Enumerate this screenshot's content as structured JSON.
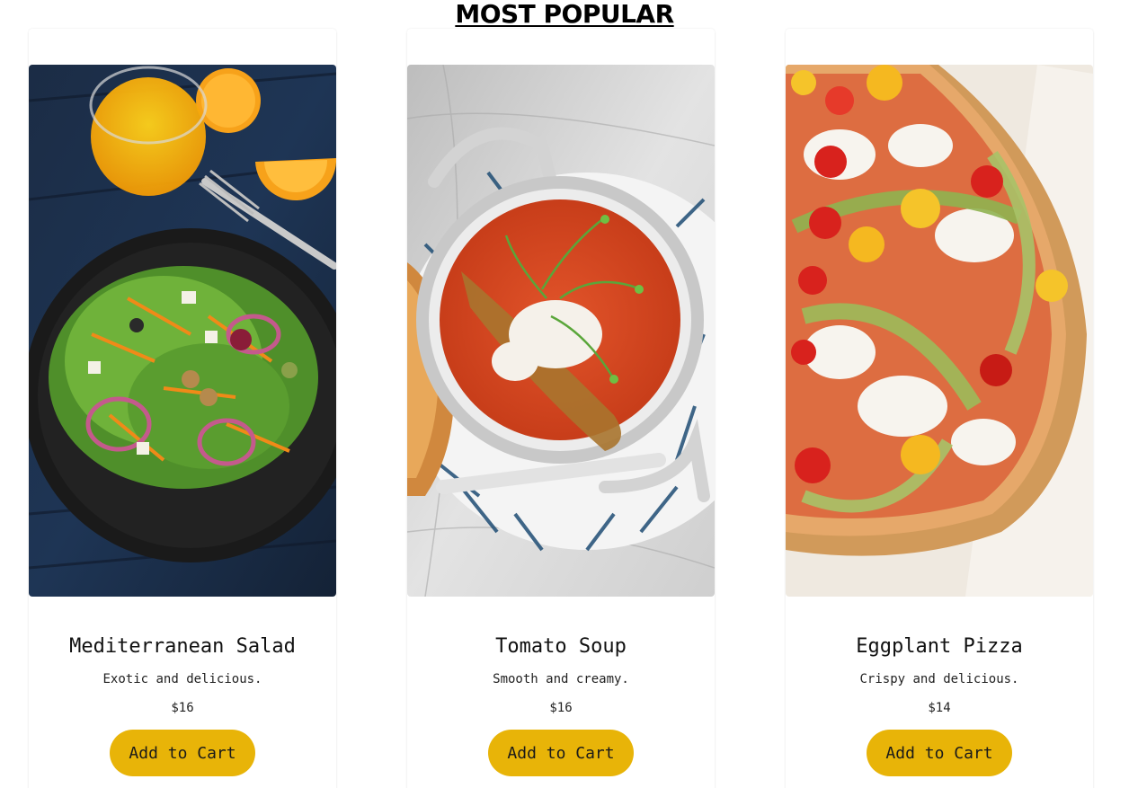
{
  "section": {
    "title": "MOST POPULAR"
  },
  "theme": {
    "button_color": "#e8b408"
  },
  "products": [
    {
      "name": "Mediterranean Salad",
      "description": "Exotic and delicious.",
      "price": "$16",
      "button_label": "Add to Cart",
      "image": "salad-photo"
    },
    {
      "name": "Tomato Soup",
      "description": "Smooth and creamy.",
      "price": "$16",
      "button_label": "Add to Cart",
      "image": "soup-photo"
    },
    {
      "name": "Eggplant Pizza",
      "description": "Crispy and delicious.",
      "price": "$14",
      "button_label": "Add to Cart",
      "image": "pizza-photo"
    }
  ]
}
